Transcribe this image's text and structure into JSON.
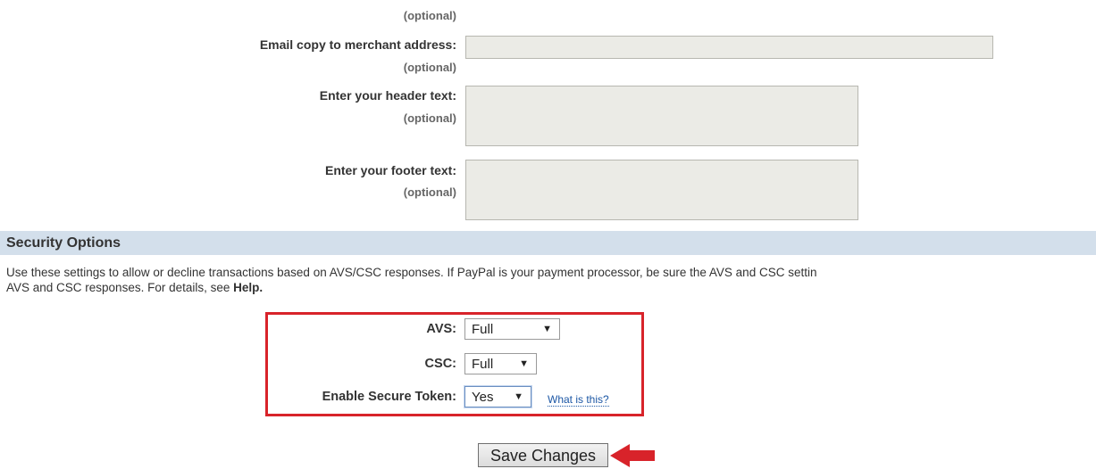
{
  "form": {
    "top_optional": "(optional)",
    "email_copy": {
      "label": "Email copy to merchant address:",
      "optional": "(optional)",
      "value": ""
    },
    "header_text": {
      "label": "Enter your header text:",
      "optional": "(optional)",
      "value": ""
    },
    "footer_text": {
      "label": "Enter your footer text:",
      "optional": "(optional)",
      "value": ""
    }
  },
  "security": {
    "title": "Security Options",
    "description_line1": "Use these settings to allow or decline transactions based on AVS/CSC responses. If PayPal is your payment processor, be sure the AVS and CSC settin",
    "description_line2_prefix": "AVS and CSC responses. For details, see ",
    "description_help_link": "Help.",
    "avs": {
      "label": "AVS:",
      "selected": "Full"
    },
    "csc": {
      "label": "CSC:",
      "selected": "Full"
    },
    "secure_token": {
      "label": "Enable Secure Token:",
      "selected": "Yes",
      "help_link": "What is this?"
    }
  },
  "actions": {
    "save_label": "Save Changes"
  },
  "colors": {
    "highlight_box": "#d8232a",
    "arrow": "#d8232a",
    "section_bar": "#d3dfeb",
    "field_bg": "#ebebe6"
  },
  "icons": {
    "dropdown": "caret-down-icon",
    "resize": "resize-grip-icon",
    "pointer": "left-arrow-icon"
  }
}
